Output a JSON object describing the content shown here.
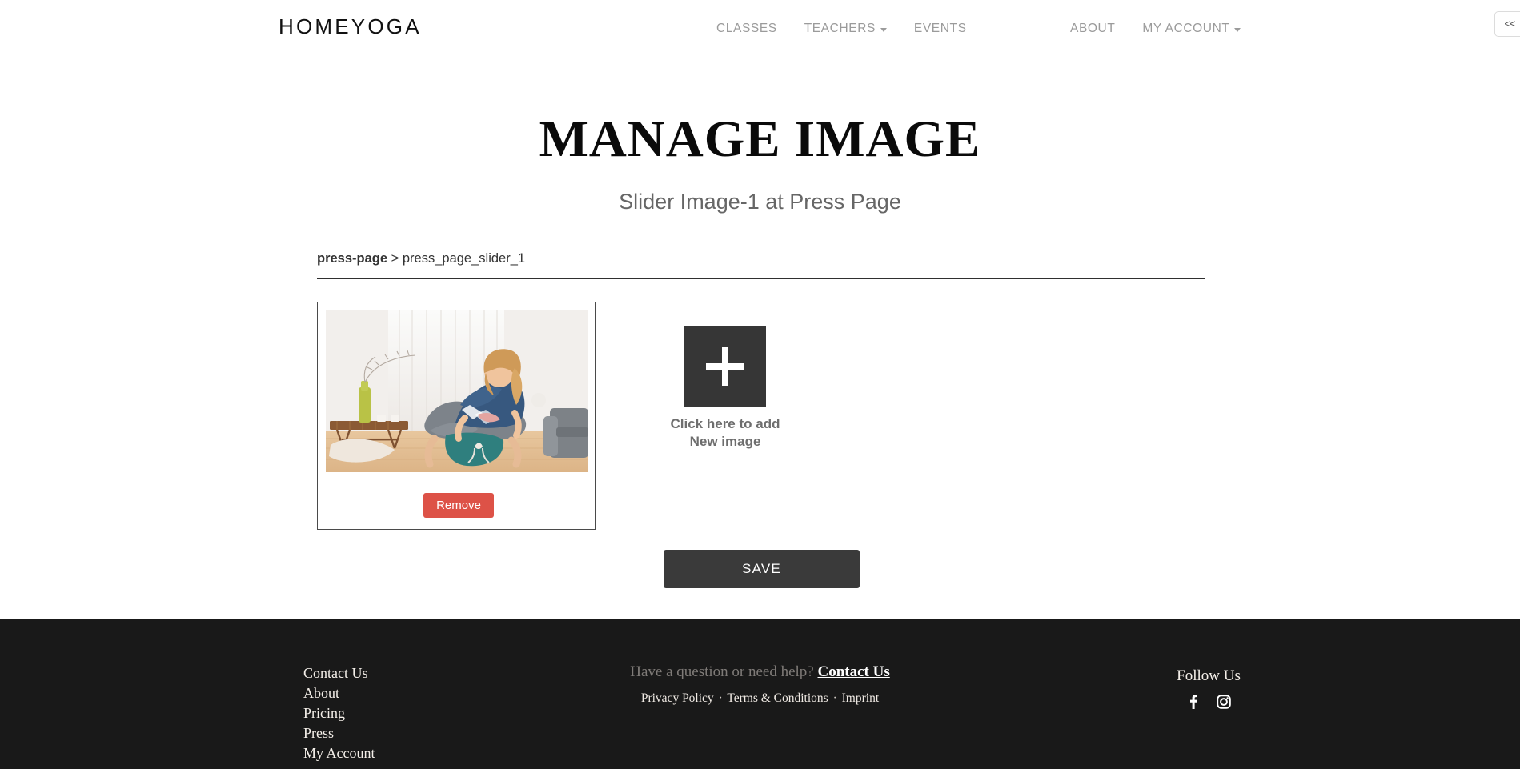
{
  "header": {
    "logo": "HOMEYOGA",
    "nav_primary": [
      {
        "label": "CLASSES",
        "has_caret": false,
        "icon": ""
      },
      {
        "label": "TEACHERS",
        "has_caret": true,
        "icon": "chevron-down-icon"
      },
      {
        "label": "EVENTS",
        "has_caret": false,
        "icon": ""
      }
    ],
    "nav_secondary": [
      {
        "label": "ABOUT",
        "has_caret": false,
        "icon": ""
      },
      {
        "label": "MY ACCOUNT",
        "has_caret": true,
        "icon": "chevron-down-icon"
      }
    ],
    "collapse_button": "<<"
  },
  "main": {
    "title": "MANAGE IMAGE",
    "subtitle": "Slider Image-1 at Press Page",
    "breadcrumb": {
      "current": "press-page",
      "separator": ">",
      "child": "press_page_slider_1"
    },
    "image_card": {
      "image_alt": "woman assisting another woman in child's pose yoga in a living room",
      "remove_label": "Remove"
    },
    "add_tile": {
      "icon": "plus-icon",
      "label_line1": "Click here to add",
      "label_line2": "New image"
    },
    "save_label": "SAVE"
  },
  "footer": {
    "links": [
      {
        "label": "Contact Us"
      },
      {
        "label": "About"
      },
      {
        "label": "Pricing"
      },
      {
        "label": "Press"
      },
      {
        "label": "My Account"
      }
    ],
    "help_text": "Have a question or need help?",
    "help_link": "Contact Us",
    "legal": [
      {
        "label": "Privacy Policy"
      },
      {
        "label": "Terms & Conditions"
      },
      {
        "label": "Imprint"
      }
    ],
    "legal_separator": "·",
    "follow_title": "Follow Us",
    "social": [
      {
        "name": "facebook-icon"
      },
      {
        "name": "instagram-icon"
      }
    ]
  },
  "colors": {
    "accent_remove": "#dd5247",
    "dark": "#363636",
    "footer_bg": "#191919",
    "nav_text": "#9b9b9b"
  }
}
